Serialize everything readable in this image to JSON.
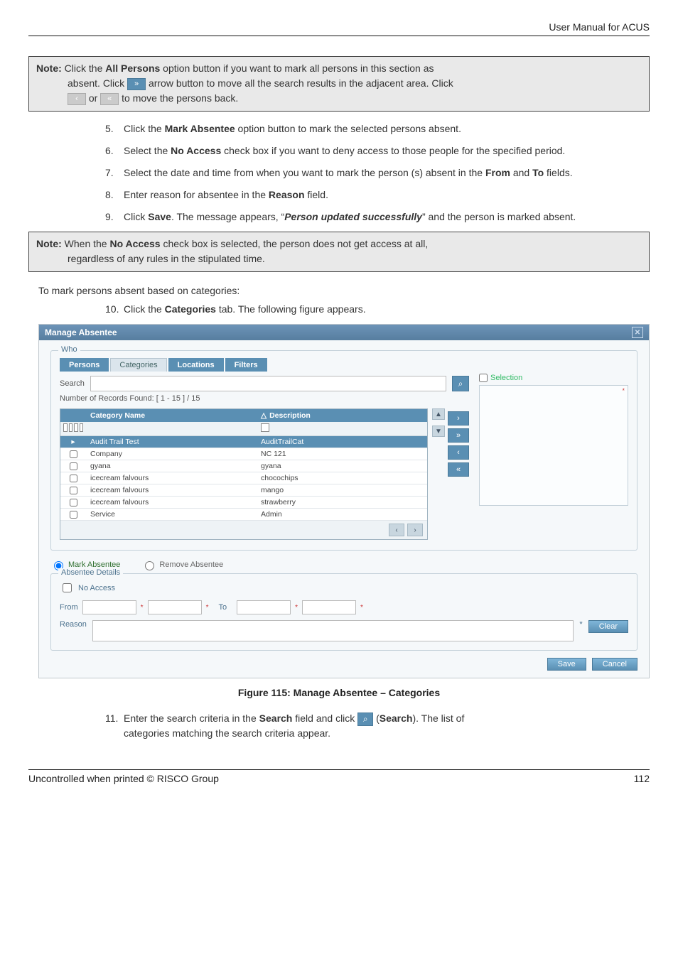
{
  "header": {
    "doc_title": "User Manual for ACUS"
  },
  "note1": {
    "prefix": "Note:",
    "l1a": " Click the ",
    "all_persons": "All Persons",
    "l1b": " option button if you want to mark all persons in this section as",
    "l2a": "absent. Click ",
    "l2b": " arrow button to move all the search results in the adjacent area. Click",
    "l3a": " or ",
    "l3b": " to move the persons back."
  },
  "steps_a": [
    {
      "n": "5.",
      "pre": "Click the ",
      "bold": "Mark Absentee",
      "rest": " option button to mark the selected persons absent."
    },
    {
      "n": "6.",
      "pre": "Select the ",
      "bold": "No Access",
      "rest": " check box if you want to deny access to those people for the specified period."
    },
    {
      "n": "7.",
      "pre": "Select the date and time from when you want to mark the person (s) absent in the ",
      "bold": "From",
      "mid": " and ",
      "bold2": "To",
      "rest": " fields."
    },
    {
      "n": "8.",
      "pre": "Enter reason for absentee in the ",
      "bold": "Reason",
      "rest": " field."
    },
    {
      "n": "9.",
      "pre": "Click ",
      "bold": "Save",
      "rest_a": ". The message appears, “",
      "ital": "Person updated successfully",
      "rest_b": "” and the person is marked absent."
    }
  ],
  "note2": {
    "prefix": "Note:",
    "l1a": " When the ",
    "bold": "No Access",
    "l1b": " check box is selected, the person does not get access at all,",
    "l2": "regardless of any rules in the stipulated time."
  },
  "para1": "To mark persons absent based on categories:",
  "step10": {
    "n": "10.",
    "pre": "Click the ",
    "bold": "Categories",
    "rest": " tab. The following figure appears."
  },
  "fig": {
    "title": "Manage Absentee",
    "who": "Who",
    "tabs": [
      "Persons",
      "Categories",
      "Locations",
      "Filters"
    ],
    "search_label": "Search",
    "records": "Number of Records Found: [ 1 - 15 ] / 15",
    "col_cat": "Category Name",
    "col_desc": "Description",
    "rows": [
      {
        "cat": "Audit Trail Test",
        "desc": "AuditTrailCat",
        "sel": true
      },
      {
        "cat": "Company",
        "desc": "NC 121"
      },
      {
        "cat": "gyana",
        "desc": "gyana"
      },
      {
        "cat": "icecream falvours",
        "desc": "chocochips"
      },
      {
        "cat": "icecream falvours",
        "desc": "mango"
      },
      {
        "cat": "icecream falvours",
        "desc": "strawberry"
      },
      {
        "cat": "Service",
        "desc": "Admin"
      }
    ],
    "selection": "Selection",
    "mark": "Mark Absentee",
    "remove": "Remove Absentee",
    "details": "Absentee Details",
    "no_access": "No Access",
    "from": "From",
    "to": "To",
    "reason": "Reason",
    "clear": "Clear",
    "save": "Save",
    "cancel": "Cancel",
    "sort_asc": "△",
    "desc_filter_icon": "▣"
  },
  "figure_caption": "Figure 115: Manage Absentee – Categories",
  "step11": {
    "n": "11.",
    "pre": "Enter the search criteria in the ",
    "bold": "Search",
    "mid": " field and click ",
    "paren_open": " (",
    "bold2": "Search",
    "paren_close": "). The list of",
    "line2": "categories matching the search criteria appear."
  },
  "footer": {
    "left": "Uncontrolled when printed © RISCO Group",
    "right": "112"
  },
  "glyphs": {
    "right_dbl": "»",
    "left_single": "‹",
    "left_dbl": "«",
    "right_single": "›",
    "magnify": "⌕",
    "tri_down": "▼",
    "tri_up": "▲"
  }
}
